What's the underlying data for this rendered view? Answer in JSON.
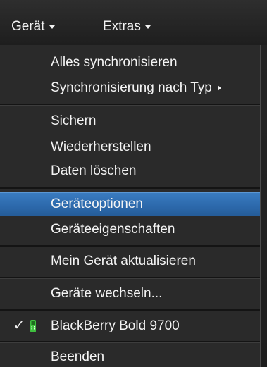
{
  "menubar": {
    "device_label": "Gerät",
    "extras_label": "Extras"
  },
  "menu": {
    "sync_all": "Alles synchronisieren",
    "sync_by_type": "Synchronisierung nach Typ",
    "backup": "Sichern",
    "restore": "Wiederherstellen",
    "delete_data": "Daten löschen",
    "device_options": "Geräteoptionen",
    "device_properties": "Geräteeigenschaften",
    "update_device": "Mein Gerät aktualisieren",
    "switch_devices": "Geräte wechseln...",
    "current_device": "BlackBerry Bold 9700",
    "quit": "Beenden",
    "selected_item": "Geräteoptionen"
  },
  "colors": {
    "highlight": "#2d6aad",
    "device_icon": "#3fbf3f"
  },
  "icons": {
    "check": "checkmark-icon",
    "device": "blackberry-device-icon",
    "submenu": "chevron-right-icon"
  }
}
